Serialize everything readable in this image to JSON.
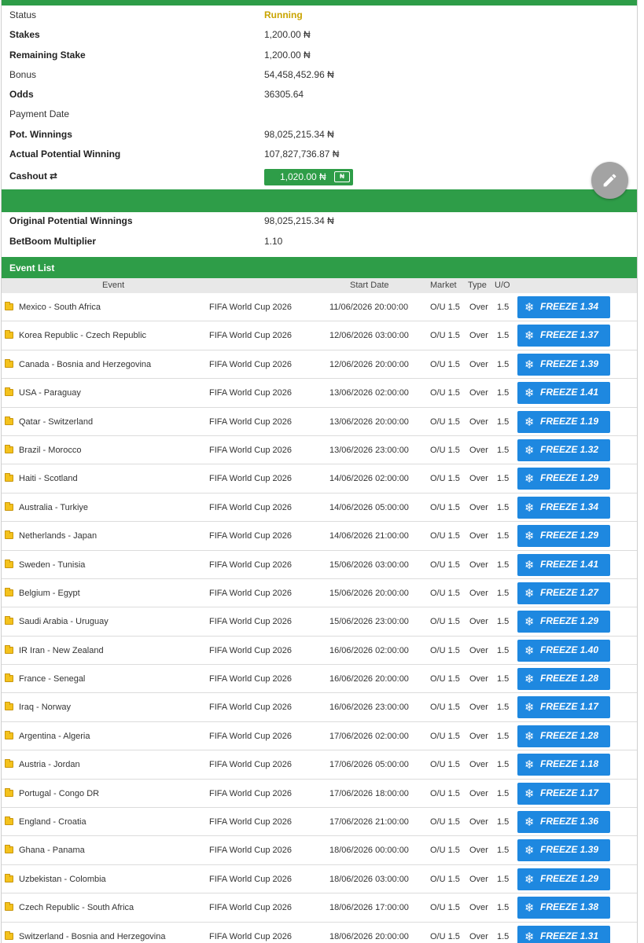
{
  "summary": {
    "status_label": "Status",
    "status_value": "Running",
    "stakes_label": "Stakes",
    "stakes_value": "1,200.00 ₦",
    "remaining_label": "Remaining Stake",
    "remaining_value": "1,200.00 ₦",
    "bonus_label": "Bonus",
    "bonus_value": "54,458,452.96 ₦",
    "odds_label": "Odds",
    "odds_value": "36305.64",
    "payment_label": "Payment Date",
    "payment_value": "",
    "pot_label": "Pot. Winnings",
    "pot_value": "98,025,215.34 ₦",
    "actual_label": "Actual Potential Winning",
    "actual_value": "107,827,736.87 ₦",
    "cashout_label": "Cashout",
    "cashout_value": "1,020.00 ₦",
    "cashout_icon_text": "₦"
  },
  "extra": {
    "original_label": "Original Potential Winnings",
    "original_value": "98,025,215.34 ₦",
    "multiplier_label": "BetBoom Multiplier",
    "multiplier_value": "1.10"
  },
  "event_list": {
    "title": "Event List",
    "headers": {
      "event": "Event",
      "start_date": "Start Date",
      "market": "Market",
      "type": "Type",
      "uo": "U/O"
    },
    "rows": [
      {
        "event": "Mexico - South Africa",
        "competition": "FIFA World Cup 2026",
        "date": "11/06/2026 20:00:00",
        "market": "O/U 1.5",
        "type": "Over",
        "uo": "1.5",
        "freeze": "FREEZE 1.34"
      },
      {
        "event": "Korea Republic - Czech Republic",
        "competition": "FIFA World Cup 2026",
        "date": "12/06/2026 03:00:00",
        "market": "O/U 1.5",
        "type": "Over",
        "uo": "1.5",
        "freeze": "FREEZE 1.37"
      },
      {
        "event": "Canada - Bosnia and Herzegovina",
        "competition": "FIFA World Cup 2026",
        "date": "12/06/2026 20:00:00",
        "market": "O/U 1.5",
        "type": "Over",
        "uo": "1.5",
        "freeze": "FREEZE 1.39"
      },
      {
        "event": "USA - Paraguay",
        "competition": "FIFA World Cup 2026",
        "date": "13/06/2026 02:00:00",
        "market": "O/U 1.5",
        "type": "Over",
        "uo": "1.5",
        "freeze": "FREEZE 1.41"
      },
      {
        "event": "Qatar - Switzerland",
        "competition": "FIFA World Cup 2026",
        "date": "13/06/2026 20:00:00",
        "market": "O/U 1.5",
        "type": "Over",
        "uo": "1.5",
        "freeze": "FREEZE 1.19"
      },
      {
        "event": "Brazil - Morocco",
        "competition": "FIFA World Cup 2026",
        "date": "13/06/2026 23:00:00",
        "market": "O/U 1.5",
        "type": "Over",
        "uo": "1.5",
        "freeze": "FREEZE 1.32"
      },
      {
        "event": "Haiti - Scotland",
        "competition": "FIFA World Cup 2026",
        "date": "14/06/2026 02:00:00",
        "market": "O/U 1.5",
        "type": "Over",
        "uo": "1.5",
        "freeze": "FREEZE 1.29"
      },
      {
        "event": "Australia - Turkiye",
        "competition": "FIFA World Cup 2026",
        "date": "14/06/2026 05:00:00",
        "market": "O/U 1.5",
        "type": "Over",
        "uo": "1.5",
        "freeze": "FREEZE 1.34"
      },
      {
        "event": "Netherlands - Japan",
        "competition": "FIFA World Cup 2026",
        "date": "14/06/2026 21:00:00",
        "market": "O/U 1.5",
        "type": "Over",
        "uo": "1.5",
        "freeze": "FREEZE 1.29"
      },
      {
        "event": "Sweden - Tunisia",
        "competition": "FIFA World Cup 2026",
        "date": "15/06/2026 03:00:00",
        "market": "O/U 1.5",
        "type": "Over",
        "uo": "1.5",
        "freeze": "FREEZE 1.41"
      },
      {
        "event": "Belgium - Egypt",
        "competition": "FIFA World Cup 2026",
        "date": "15/06/2026 20:00:00",
        "market": "O/U 1.5",
        "type": "Over",
        "uo": "1.5",
        "freeze": "FREEZE 1.27"
      },
      {
        "event": "Saudi Arabia - Uruguay",
        "competition": "FIFA World Cup 2026",
        "date": "15/06/2026 23:00:00",
        "market": "O/U 1.5",
        "type": "Over",
        "uo": "1.5",
        "freeze": "FREEZE 1.29"
      },
      {
        "event": "IR Iran - New Zealand",
        "competition": "FIFA World Cup 2026",
        "date": "16/06/2026 02:00:00",
        "market": "O/U 1.5",
        "type": "Over",
        "uo": "1.5",
        "freeze": "FREEZE 1.40"
      },
      {
        "event": "France - Senegal",
        "competition": "FIFA World Cup 2026",
        "date": "16/06/2026 20:00:00",
        "market": "O/U 1.5",
        "type": "Over",
        "uo": "1.5",
        "freeze": "FREEZE 1.28"
      },
      {
        "event": "Iraq - Norway",
        "competition": "FIFA World Cup 2026",
        "date": "16/06/2026 23:00:00",
        "market": "O/U 1.5",
        "type": "Over",
        "uo": "1.5",
        "freeze": "FREEZE 1.17"
      },
      {
        "event": "Argentina - Algeria",
        "competition": "FIFA World Cup 2026",
        "date": "17/06/2026 02:00:00",
        "market": "O/U 1.5",
        "type": "Over",
        "uo": "1.5",
        "freeze": "FREEZE 1.28"
      },
      {
        "event": "Austria - Jordan",
        "competition": "FIFA World Cup 2026",
        "date": "17/06/2026 05:00:00",
        "market": "O/U 1.5",
        "type": "Over",
        "uo": "1.5",
        "freeze": "FREEZE 1.18"
      },
      {
        "event": "Portugal - Congo DR",
        "competition": "FIFA World Cup 2026",
        "date": "17/06/2026 18:00:00",
        "market": "O/U 1.5",
        "type": "Over",
        "uo": "1.5",
        "freeze": "FREEZE 1.17"
      },
      {
        "event": "England - Croatia",
        "competition": "FIFA World Cup 2026",
        "date": "17/06/2026 21:00:00",
        "market": "O/U 1.5",
        "type": "Over",
        "uo": "1.5",
        "freeze": "FREEZE 1.36"
      },
      {
        "event": "Ghana - Panama",
        "competition": "FIFA World Cup 2026",
        "date": "18/06/2026 00:00:00",
        "market": "O/U 1.5",
        "type": "Over",
        "uo": "1.5",
        "freeze": "FREEZE 1.39"
      },
      {
        "event": "Uzbekistan - Colombia",
        "competition": "FIFA World Cup 2026",
        "date": "18/06/2026 03:00:00",
        "market": "O/U 1.5",
        "type": "Over",
        "uo": "1.5",
        "freeze": "FREEZE 1.29"
      },
      {
        "event": "Czech Republic - South Africa",
        "competition": "FIFA World Cup 2026",
        "date": "18/06/2026 17:00:00",
        "market": "O/U 1.5",
        "type": "Over",
        "uo": "1.5",
        "freeze": "FREEZE 1.38"
      },
      {
        "event": "Switzerland - Bosnia and Herzegovina",
        "competition": "FIFA World Cup 2026",
        "date": "18/06/2026 20:00:00",
        "market": "O/U 1.5",
        "type": "Over",
        "uo": "1.5",
        "freeze": "FREEZE 1.31"
      }
    ]
  },
  "icons": {
    "folder": "folder-icon",
    "snowflake": "snowflake-icon",
    "edit": "pencil-icon",
    "refresh": "refresh-icon",
    "cash": "banknote-icon"
  },
  "colors": {
    "brand_green": "#2e9d48",
    "status_running": "#c9a400",
    "freeze_blue": "#1e88e0",
    "fab_grey": "#a3a3a3"
  }
}
